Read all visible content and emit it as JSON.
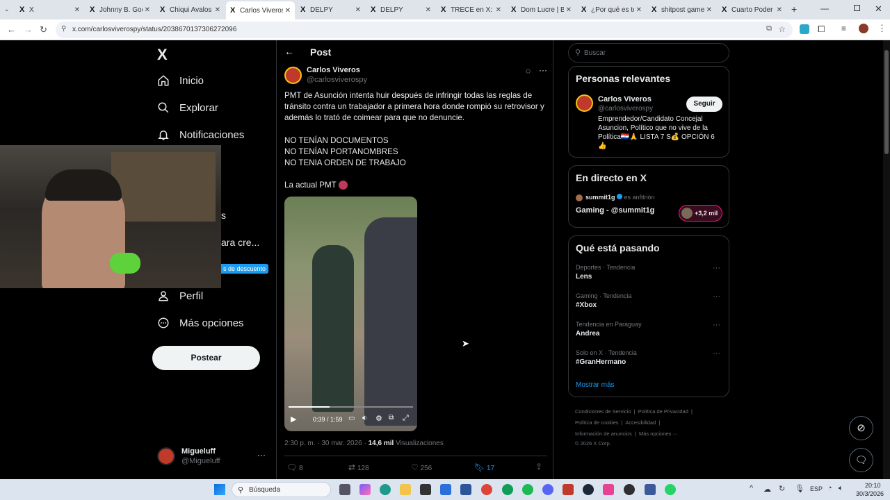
{
  "browser": {
    "tabs": [
      {
        "label": "X",
        "active": false
      },
      {
        "label": "Johnny B. Goo",
        "active": false
      },
      {
        "label": "Chiqui Avalos",
        "active": false
      },
      {
        "label": "Carlos Viveros",
        "active": true
      },
      {
        "label": "DELPY",
        "active": false
      },
      {
        "label": "DELPY",
        "active": false
      },
      {
        "label": "TRECE en X:",
        "active": false
      },
      {
        "label": "Dom Lucre | Bi",
        "active": false
      },
      {
        "label": "¿Por qué es te",
        "active": false
      },
      {
        "label": "shitpost game",
        "active": false
      },
      {
        "label": "Cuarto Poder",
        "active": false
      }
    ],
    "url": "x.com/carlosviverospy/status/2038670137306272096",
    "new_tab": "+"
  },
  "sidebar": {
    "logo": "X",
    "items": [
      {
        "label": "Inicio",
        "icon": "home-icon"
      },
      {
        "label": "Explorar",
        "icon": "search-icon"
      },
      {
        "label": "Notificaciones",
        "icon": "bell-icon"
      },
      {
        "label": "Perfil",
        "icon": "person-icon"
      },
      {
        "label": "Más opciones",
        "icon": "more-circle-icon"
      }
    ],
    "partial_labels": [
      "s",
      "ara cre..."
    ],
    "discount_badge": "s de descuento",
    "post_button": "Postear",
    "account": {
      "name": "Migueluff",
      "handle": "@Migueluff",
      "more": "···"
    }
  },
  "post": {
    "header": "Post",
    "author_name": "Carlos Viveros",
    "author_handle": "@carlosviverospy",
    "paragraph1": "PMT de Asunción intenta huir después de infringir todas las reglas de tránsito contra un trabajador a primera hora donde rompió su retrovisor y además lo trató de coimear para que no denuncie.",
    "lines": [
      "NO TENÍAN DOCUMENTOS",
      "NO TENÍAN PORTANOMBRES",
      "NO TENIA ORDEN DE TRABAJO"
    ],
    "closing": "La actual PMT",
    "video_time": "0:39 / 1:59",
    "timestamp": "2:30 p. m. · 30 mar. 2026 ·",
    "views_count": "14,6 mil",
    "views_label": "Visualizaciones",
    "actions": {
      "replies": "8",
      "reposts": "128",
      "likes": "256",
      "bookmarks": "17"
    }
  },
  "right": {
    "search_placeholder": "Buscar",
    "relevant": {
      "title": "Personas relevantes",
      "name": "Carlos Viveros",
      "handle": "@carlosviverospy",
      "follow": "Seguir",
      "bio": "Emprendedor/Candidato Concejal Asuncion, Político que no vive de la Política🇵🇾🙏 LISTA 7 S💰 OPCIÓN 6 👍"
    },
    "live": {
      "title": "En directo en X",
      "host": "summit1g",
      "host_role": "es anfitrión",
      "stream": "Gaming - @summit1g",
      "listeners": "+3,2 mil"
    },
    "trends": {
      "title": "Qué está pasando",
      "items": [
        {
          "context": "Deportes · Tendencia",
          "name": "Lens"
        },
        {
          "context": "Gaming · Tendencia",
          "name": "#Xbox"
        },
        {
          "context": "Tendencia en Paraguay",
          "name": "Andrea"
        },
        {
          "context": "Solo en X · Tendencia",
          "name": "#GranHermano"
        }
      ],
      "more": "Mostrar más"
    },
    "footer": [
      "Condiciones de Servicio",
      "Política de Privacidad",
      "Política de cookies",
      "Accesibilidad",
      "Información de anuncios",
      "Más opciones ···",
      "© 2026 X Corp."
    ]
  },
  "taskbar": {
    "search": "Búsqueda",
    "lang": "ESP",
    "time": "20:10",
    "date": "30/3/2026"
  }
}
